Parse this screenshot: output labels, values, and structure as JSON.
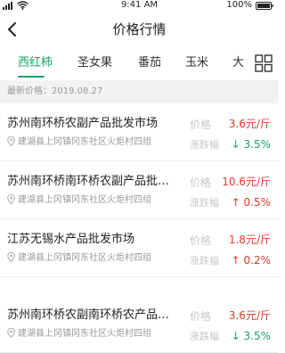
{
  "status": {
    "time": "9:41 AM",
    "battery": "100%"
  },
  "header": {
    "title": "价格行情"
  },
  "tabs": [
    "西红柿",
    "圣女果",
    "番茄",
    "玉米",
    "大"
  ],
  "latest_price_date": "最新价格：2019.08.27",
  "labels": {
    "price": "价格",
    "change": "涨跌幅"
  },
  "rows": [
    {
      "name": "苏州南环桥农副产品批发市场",
      "location": "建湖县上冈镇冈东社区火炬村四组",
      "price": "3.6元/斤",
      "change_arrow": "↓",
      "change": "3.5%",
      "direction": "down"
    },
    {
      "name": "苏州南环桥南环桥农副产品批…",
      "location": "建湖县上冈镇冈东社区火炬村四组",
      "price": "10.6元/斤",
      "change_arrow": "↑",
      "change": "0.5%",
      "direction": "up"
    },
    {
      "name": "江苏无锡水产品批发市场",
      "location": "建湖县上冈镇冈东社区火炬村四组",
      "price": "1.8元/斤",
      "change_arrow": "↑",
      "change": "0.2%",
      "direction": "up"
    },
    {
      "name": "苏州南环桥农副南环桥农产品…",
      "location": "建湖县上冈镇冈东社区火炬村四组",
      "price": "3.6元/斤",
      "change_arrow": "↓",
      "change": "3.5%",
      "direction": "down"
    }
  ],
  "colors": {
    "accent": "#1aa26a",
    "up": "#e0392f",
    "down": "#1aa26a"
  },
  "icons": {
    "back": "chevron-left-icon",
    "grid": "grid-icon",
    "location": "location-pin-icon"
  }
}
